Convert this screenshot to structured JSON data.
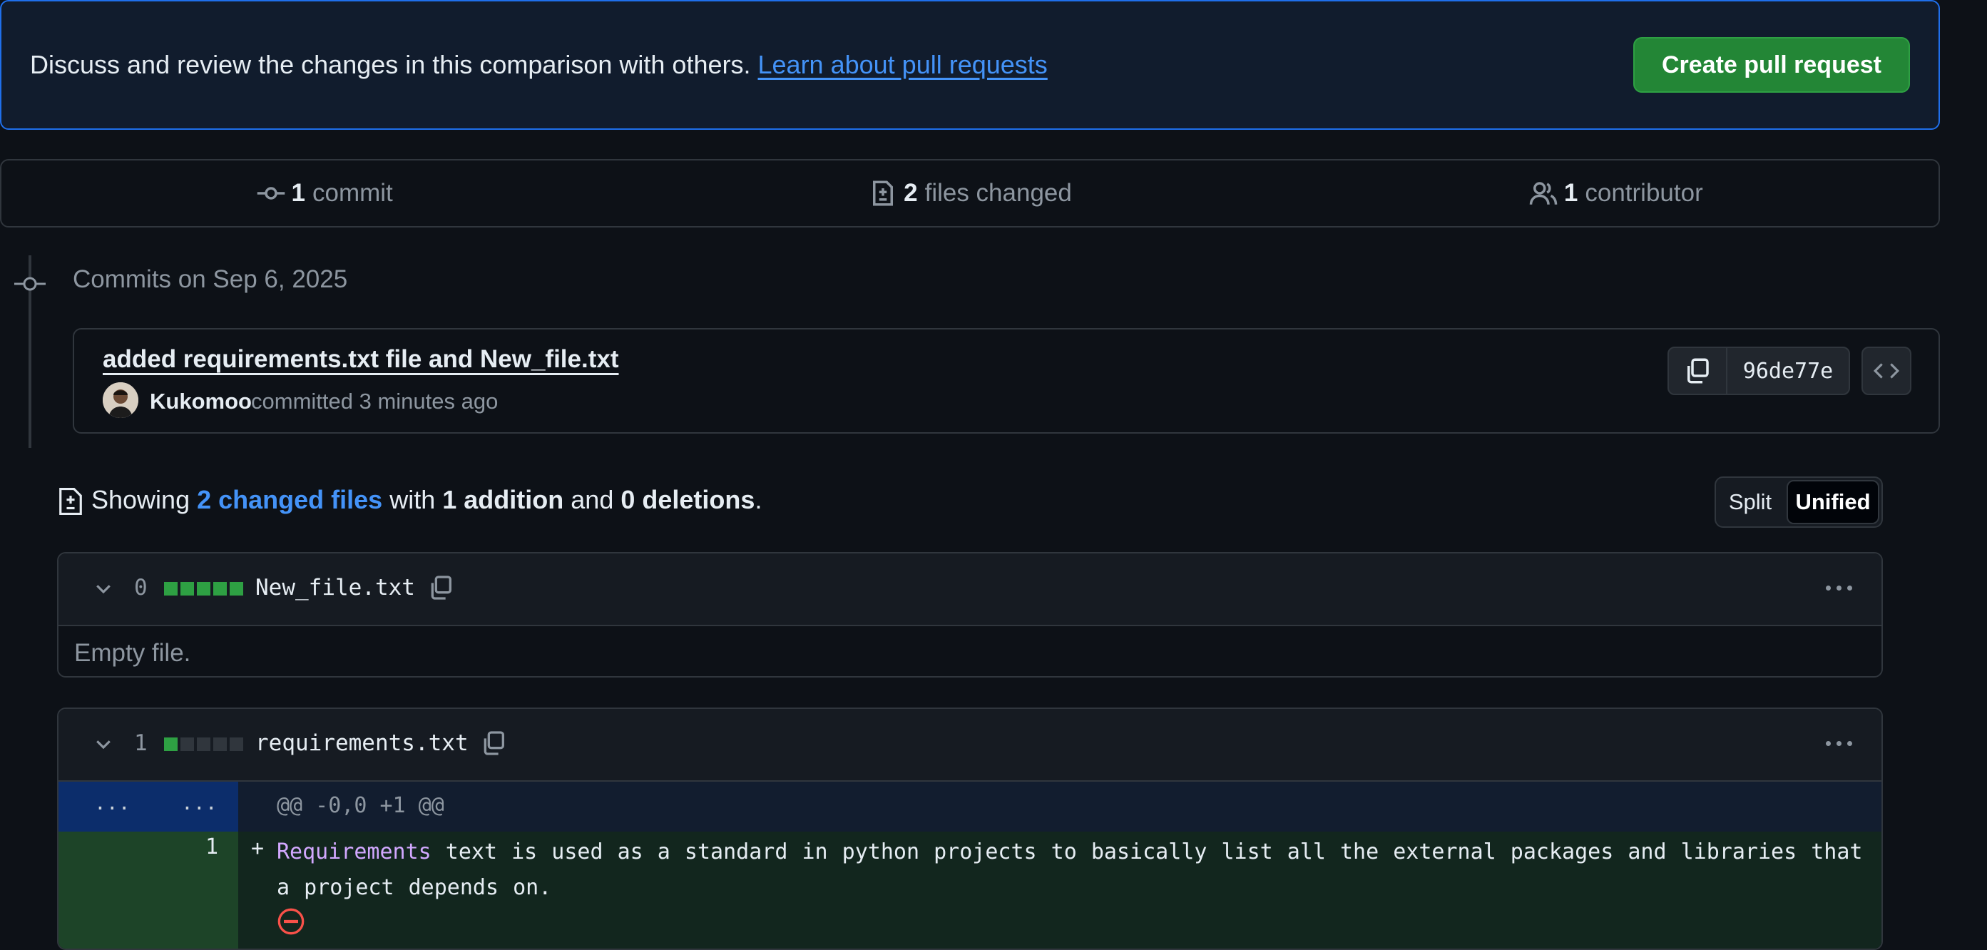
{
  "banner": {
    "text": "Discuss and review the changes in this comparison with others.",
    "link": "Learn about pull requests",
    "create_button": "Create pull request"
  },
  "summary": {
    "commits": {
      "count": "1",
      "label": "commit",
      "icon": "git-commit-icon"
    },
    "files": {
      "count": "2",
      "label": "files changed",
      "icon": "file-diff-icon"
    },
    "contributors": {
      "count": "1",
      "label": "contributor",
      "icon": "people-icon"
    }
  },
  "commits": {
    "heading": "Commits on Sep 6, 2025",
    "items": [
      {
        "title": "added requirements.txt file and New_file.txt",
        "author": "Kukomoo",
        "meta": "committed 3 minutes ago",
        "sha": "96de77e"
      }
    ]
  },
  "showing": {
    "prefix": "Showing",
    "files_link": "2 changed files",
    "with": "with",
    "additions": "1 addition",
    "and": "and",
    "deletions": "0 deletions",
    "suffix": "."
  },
  "view_toggle": {
    "split": "Split",
    "unified": "Unified",
    "selected": "Unified"
  },
  "files": [
    {
      "count": "0",
      "name": "New_file.txt",
      "diffstat": [
        "#2ea043",
        "#2ea043",
        "#2ea043",
        "#2ea043",
        "#2ea043"
      ],
      "empty_message": "Empty file."
    },
    {
      "count": "1",
      "name": "requirements.txt",
      "diffstat": [
        "#2ea043",
        "#30363d",
        "#30363d",
        "#30363d",
        "#30363d"
      ],
      "hunk_left": "...",
      "hunk_right": "...",
      "hunk_header": "@@ -0,0 +1 @@",
      "lines": [
        {
          "number": "1",
          "sign": "+",
          "keyword": "Requirements",
          "text": " text is used as a standard in python projects to basically list all the external packages and libraries that a project depends on."
        }
      ]
    }
  ]
}
